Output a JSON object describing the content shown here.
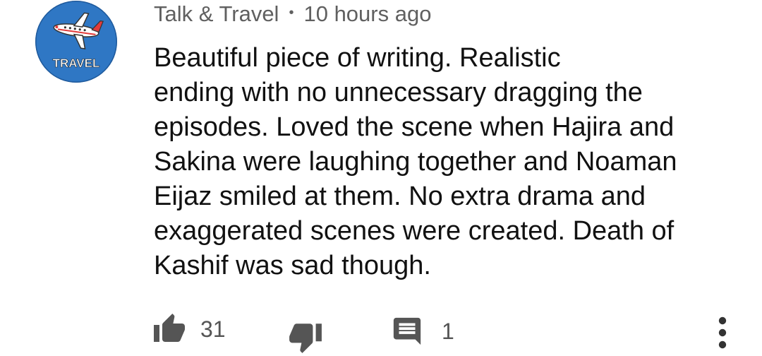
{
  "comment": {
    "author": "Talk & Travel",
    "separator": "•",
    "timestamp": "10 hours ago",
    "avatar_text": "TRAVEL",
    "text_lines": [
      "Beautiful piece of writing. Realistic",
      "ending with no unnecessary dragging the",
      "episodes. Loved the scene when Hajira and",
      "Sakina were laughing together and Noaman",
      "Eijaz smiled at them. No extra drama and",
      "exaggerated scenes were created. Death of",
      "Kashif was sad though."
    ],
    "likes": "31",
    "replies": "1"
  },
  "icons": {
    "like": "thumbs-up-icon",
    "dislike": "thumbs-down-icon",
    "reply": "comment-icon",
    "more": "more-vert-icon"
  },
  "colors": {
    "avatar_bg": "#2f77c4",
    "meta_text": "#606060",
    "icon": "#555555"
  }
}
